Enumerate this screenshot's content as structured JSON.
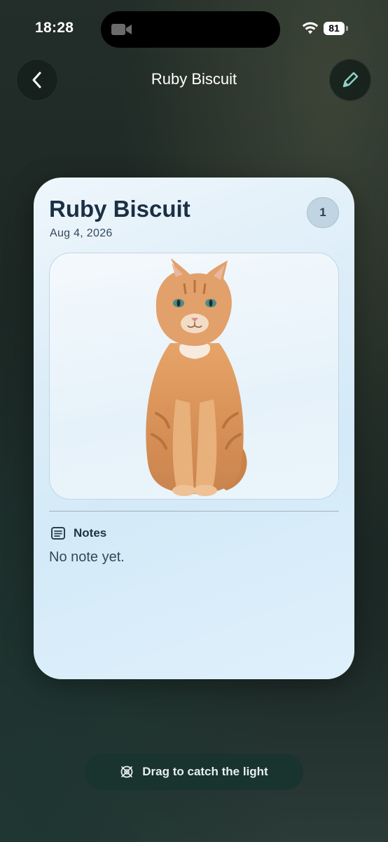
{
  "status_bar": {
    "time": "18:28",
    "battery": "81",
    "icons": [
      "video-camera-icon",
      "wifi-icon",
      "battery-icon"
    ]
  },
  "nav": {
    "title": "Ruby Biscuit",
    "back_icon": "chevron-left-icon",
    "edit_icon": "pencil-icon"
  },
  "card": {
    "title": "Ruby Biscuit",
    "date": "Aug 4, 2026",
    "count": "1",
    "photo": "orange tabby cat sitting",
    "notes": {
      "label": "Notes",
      "icon": "notes-icon",
      "text": "No note yet."
    }
  },
  "bottom_action": {
    "label": "Drag to catch the light",
    "icon": "light-target-icon"
  },
  "colors": {
    "accent_pencil": "#8fd1c7",
    "card_title": "#1b2f45",
    "pill_bg": "#19332f"
  }
}
